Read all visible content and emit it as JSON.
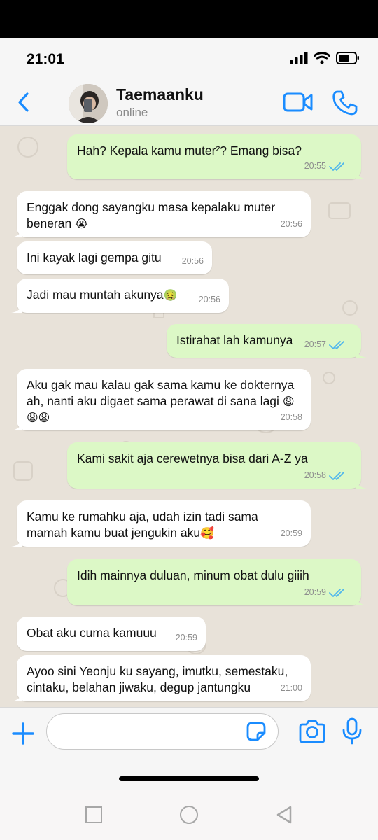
{
  "status": {
    "time": "21:01"
  },
  "header": {
    "contact_name": "Taemaanku",
    "contact_status": "online"
  },
  "messages": [
    {
      "dir": "out",
      "text": "Hah? Kepala kamu muter²? Emang bisa?",
      "time": "20:55",
      "read": true
    },
    {
      "dir": "in",
      "text": "Enggak dong sayangku masa kepalaku muter beneran",
      "emoji": "😭",
      "time": "20:56"
    },
    {
      "dir": "in",
      "text": "Ini kayak lagi gempa gitu",
      "time": "20:56"
    },
    {
      "dir": "in",
      "text": "Jadi mau muntah akunya",
      "emoji": "🤢",
      "time": "20:56"
    },
    {
      "dir": "out",
      "text": "Istirahat lah kamunya",
      "time": "20:57",
      "read": true
    },
    {
      "dir": "in",
      "text": "Aku gak mau kalau gak sama kamu ke dokternya ah, nanti aku digaet sama perawat di sana lagi",
      "emoji": "😩😩😩",
      "time": "20:58"
    },
    {
      "dir": "out",
      "text": "Kami sakit aja cerewetnya bisa dari A-Z ya",
      "time": "20:58",
      "read": true
    },
    {
      "dir": "in",
      "text": "Kamu ke rumahku aja, udah izin tadi sama mamah kamu buat jengukin aku",
      "emoji": "🥰",
      "time": "20:59"
    },
    {
      "dir": "out",
      "text": "Idih mainnya duluan, minum obat dulu giiih",
      "time": "20:59",
      "read": true
    },
    {
      "dir": "in",
      "text": "Obat aku cuma kamuuu",
      "time": "20:59"
    },
    {
      "dir": "in",
      "text": "Ayoo sini Yeonju ku sayang, imutku, semestaku, cintaku, belahan jiwaku, degup jantungku",
      "time": "21:00"
    }
  ],
  "input": {
    "value": "",
    "placeholder": ""
  },
  "colors": {
    "accent": "#1a8cff",
    "outgoing": "#dcf8c6",
    "incoming": "#ffffff",
    "wallpaper": "#e8e2d9",
    "read_ticks": "#4fb6ec"
  }
}
